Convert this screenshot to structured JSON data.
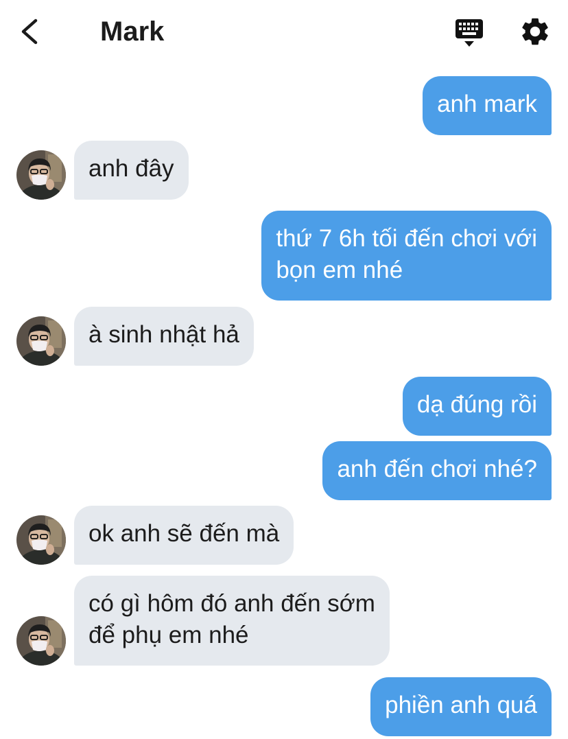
{
  "header": {
    "title": "Mark",
    "back_icon": "chevron-left-icon",
    "keyboard_icon": "keyboard-icon",
    "settings_icon": "gear-icon"
  },
  "colors": {
    "outgoing_bubble": "#4c9ee8",
    "incoming_bubble": "#e5e9ee",
    "title_text": "#1b1b1b"
  },
  "messages": [
    {
      "from": "me",
      "lines": [
        "anh mark"
      ]
    },
    {
      "from": "Mark",
      "lines": [
        "anh đây"
      ]
    },
    {
      "from": "me",
      "lines": [
        "thứ 7 6h tối đến chơi với",
        "bọn em nhé"
      ]
    },
    {
      "from": "Mark",
      "lines": [
        "à sinh nhật hả"
      ]
    },
    {
      "from": "me",
      "lines": [
        "dạ đúng rồi"
      ]
    },
    {
      "from": "me",
      "lines": [
        "anh đến chơi nhé?"
      ]
    },
    {
      "from": "Mark",
      "lines": [
        "ok anh sẽ đến mà"
      ]
    },
    {
      "from": "Mark",
      "lines": [
        "có gì hôm đó anh đến sớm",
        "để phụ em nhé"
      ]
    },
    {
      "from": "me",
      "lines": [
        "phiền anh quá"
      ]
    }
  ]
}
